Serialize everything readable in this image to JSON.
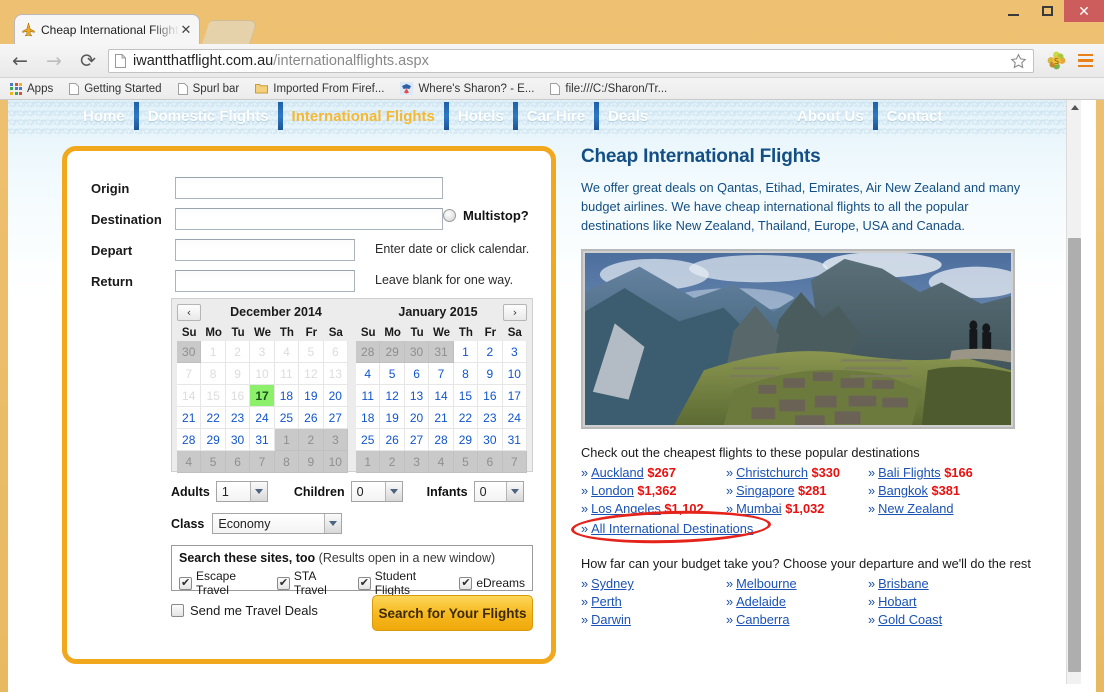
{
  "browser": {
    "tab": {
      "title": "Cheap International Flight",
      "favicon": "airplane-icon",
      "close": "✕"
    },
    "window": {
      "minimize": "–",
      "maximize": "▢",
      "close": "✕"
    },
    "nav": {
      "back": "←",
      "forward": "→",
      "reload": "⟳"
    },
    "omnibox": {
      "url_bold": "iwantthatflight.com.au",
      "url_dim": "/internationalflights.aspx",
      "star": "☆"
    },
    "bookmarks": [
      {
        "label": "Apps",
        "icon": "apps-grid-icon"
      },
      {
        "label": "Getting Started",
        "icon": "page-icon"
      },
      {
        "label": "Spurl bar",
        "icon": "page-icon"
      },
      {
        "label": "Imported From Firef...",
        "icon": "folder-icon"
      },
      {
        "label": "Where's Sharon? - E...",
        "icon": "butterfly-icon"
      },
      {
        "label": "file:///C:/Sharon/Tr...",
        "icon": "page-icon"
      }
    ]
  },
  "site_nav": {
    "left": [
      "Home",
      "Domestic Flights",
      "International Flights",
      "Hotels",
      "Car Hire",
      "Deals"
    ],
    "right": [
      "About Us",
      "Contact"
    ],
    "active": "International Flights",
    "active_color": "#f5b831"
  },
  "form": {
    "origin": {
      "label": "Origin",
      "value": ""
    },
    "destination": {
      "label": "Destination",
      "value": ""
    },
    "multistop": {
      "label": "Multistop?",
      "checked": false
    },
    "depart": {
      "label": "Depart",
      "value": "",
      "hint": "Enter date or click calendar."
    },
    "return": {
      "label": "Return",
      "value": "",
      "hint": "Leave blank for one way."
    },
    "passengers": {
      "adults": {
        "label": "Adults",
        "value": "1"
      },
      "children": {
        "label": "Children",
        "value": "0"
      },
      "infants": {
        "label": "Infants",
        "value": "0"
      }
    },
    "travel_class": {
      "label": "Class",
      "value": "Economy"
    },
    "sites_box": {
      "title_bold": "Search these sites, too",
      "title_note": "(Results open in a new window)",
      "options": [
        {
          "label": "Escape Travel",
          "checked": true
        },
        {
          "label": "STA Travel",
          "checked": true
        },
        {
          "label": "Student Flights",
          "checked": true
        },
        {
          "label": "eDreams",
          "checked": true
        }
      ]
    },
    "travel_deals": {
      "label": "Send me Travel Deals",
      "checked": false
    },
    "submit": {
      "label": "Search for Your Flights"
    }
  },
  "calendar": {
    "prev_arrow": "‹",
    "next_arrow": "›",
    "dow": [
      "Su",
      "Mo",
      "Tu",
      "We",
      "Th",
      "Fr",
      "Sa"
    ],
    "selected_date": "2014-12-17",
    "months": [
      {
        "title": "December 2014",
        "weeks": [
          [
            {
              "d": "30",
              "s": "other"
            },
            {
              "d": "1",
              "s": "past"
            },
            {
              "d": "2",
              "s": "past"
            },
            {
              "d": "3",
              "s": "past"
            },
            {
              "d": "4",
              "s": "past"
            },
            {
              "d": "5",
              "s": "past"
            },
            {
              "d": "6",
              "s": "past"
            }
          ],
          [
            {
              "d": "7",
              "s": "past"
            },
            {
              "d": "8",
              "s": "past"
            },
            {
              "d": "9",
              "s": "past"
            },
            {
              "d": "10",
              "s": "past"
            },
            {
              "d": "11",
              "s": "past"
            },
            {
              "d": "12",
              "s": "past"
            },
            {
              "d": "13",
              "s": "past"
            }
          ],
          [
            {
              "d": "14",
              "s": "past"
            },
            {
              "d": "15",
              "s": "past"
            },
            {
              "d": "16",
              "s": "past"
            },
            {
              "d": "17",
              "s": "sel"
            },
            {
              "d": "18",
              "s": "on"
            },
            {
              "d": "19",
              "s": "on"
            },
            {
              "d": "20",
              "s": "on"
            }
          ],
          [
            {
              "d": "21",
              "s": "on"
            },
            {
              "d": "22",
              "s": "on"
            },
            {
              "d": "23",
              "s": "on"
            },
            {
              "d": "24",
              "s": "on"
            },
            {
              "d": "25",
              "s": "on"
            },
            {
              "d": "26",
              "s": "on"
            },
            {
              "d": "27",
              "s": "on"
            }
          ],
          [
            {
              "d": "28",
              "s": "on"
            },
            {
              "d": "29",
              "s": "on"
            },
            {
              "d": "30",
              "s": "on"
            },
            {
              "d": "31",
              "s": "on"
            },
            {
              "d": "1",
              "s": "other"
            },
            {
              "d": "2",
              "s": "other"
            },
            {
              "d": "3",
              "s": "other"
            }
          ],
          [
            {
              "d": "4",
              "s": "other"
            },
            {
              "d": "5",
              "s": "other"
            },
            {
              "d": "6",
              "s": "other"
            },
            {
              "d": "7",
              "s": "other"
            },
            {
              "d": "8",
              "s": "other"
            },
            {
              "d": "9",
              "s": "other"
            },
            {
              "d": "10",
              "s": "other"
            }
          ]
        ]
      },
      {
        "title": "January 2015",
        "weeks": [
          [
            {
              "d": "28",
              "s": "other"
            },
            {
              "d": "29",
              "s": "other"
            },
            {
              "d": "30",
              "s": "other"
            },
            {
              "d": "31",
              "s": "other"
            },
            {
              "d": "1",
              "s": "on"
            },
            {
              "d": "2",
              "s": "on"
            },
            {
              "d": "3",
              "s": "on"
            }
          ],
          [
            {
              "d": "4",
              "s": "on"
            },
            {
              "d": "5",
              "s": "on"
            },
            {
              "d": "6",
              "s": "on"
            },
            {
              "d": "7",
              "s": "on"
            },
            {
              "d": "8",
              "s": "on"
            },
            {
              "d": "9",
              "s": "on"
            },
            {
              "d": "10",
              "s": "on"
            }
          ],
          [
            {
              "d": "11",
              "s": "on"
            },
            {
              "d": "12",
              "s": "on"
            },
            {
              "d": "13",
              "s": "on"
            },
            {
              "d": "14",
              "s": "on"
            },
            {
              "d": "15",
              "s": "on"
            },
            {
              "d": "16",
              "s": "on"
            },
            {
              "d": "17",
              "s": "on"
            }
          ],
          [
            {
              "d": "18",
              "s": "on"
            },
            {
              "d": "19",
              "s": "on"
            },
            {
              "d": "20",
              "s": "on"
            },
            {
              "d": "21",
              "s": "on"
            },
            {
              "d": "22",
              "s": "on"
            },
            {
              "d": "23",
              "s": "on"
            },
            {
              "d": "24",
              "s": "on"
            }
          ],
          [
            {
              "d": "25",
              "s": "on"
            },
            {
              "d": "26",
              "s": "on"
            },
            {
              "d": "27",
              "s": "on"
            },
            {
              "d": "28",
              "s": "on"
            },
            {
              "d": "29",
              "s": "on"
            },
            {
              "d": "30",
              "s": "on"
            },
            {
              "d": "31",
              "s": "on"
            }
          ],
          [
            {
              "d": "1",
              "s": "other"
            },
            {
              "d": "2",
              "s": "other"
            },
            {
              "d": "3",
              "s": "other"
            },
            {
              "d": "4",
              "s": "other"
            },
            {
              "d": "5",
              "s": "other"
            },
            {
              "d": "6",
              "s": "other"
            },
            {
              "d": "7",
              "s": "other"
            }
          ]
        ]
      }
    ]
  },
  "content": {
    "title": "Cheap International Flights",
    "intro": "We offer great deals on Qantas, Etihad, Emirates, Air New Zealand and many budget airlines. We have cheap international flights to all the popular destinations like New Zealand, Thailand, Europe, USA and Canada.",
    "photo_alt": "machu-picchu-photo",
    "destinations_heading": "Check out the cheapest flights to these popular destinations",
    "destinations": [
      {
        "name": "Auckland",
        "price": "$267"
      },
      {
        "name": "Christchurch",
        "price": "$330"
      },
      {
        "name": "Bali Flights",
        "price": "$166"
      },
      {
        "name": "London",
        "price": "$1,362"
      },
      {
        "name": "Singapore",
        "price": "$281"
      },
      {
        "name": "Bangkok",
        "price": "$381"
      },
      {
        "name": "Los Angeles",
        "price": "$1,102"
      },
      {
        "name": "Mumbai",
        "price": "$1,032"
      },
      {
        "name": "New Zealand",
        "price": ""
      }
    ],
    "all_destinations_link": "All International Destinations",
    "budget_heading": "How far can your budget take you? Choose your departure and we'll do the rest",
    "departure_cities": [
      "Sydney",
      "Melbourne",
      "Brisbane",
      "Perth",
      "Adelaide",
      "Hobart",
      "Darwin",
      "Canberra",
      "Gold Coast"
    ],
    "chevron": "»",
    "annotation_color": "#e5231b"
  }
}
